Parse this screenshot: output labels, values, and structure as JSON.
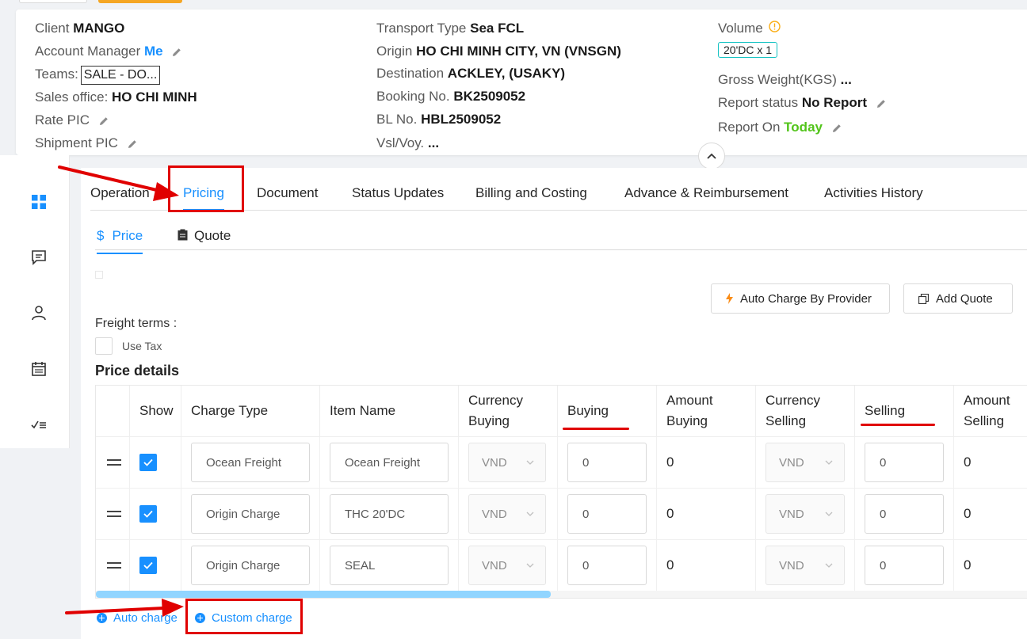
{
  "info": {
    "client_label": "Client",
    "client_value": "MANGO",
    "account_manager_label": "Account Manager",
    "account_manager_value": "Me",
    "teams_label": "Teams:",
    "teams_value": "SALE - DO...",
    "sales_office_label": "Sales office:",
    "sales_office_value": "HO CHI MINH",
    "rate_pic_label": "Rate PIC",
    "shipment_pic_label": "Shipment PIC",
    "transport_type_label": "Transport Type",
    "transport_type_value": "Sea FCL",
    "origin_label": "Origin",
    "origin_value": "HO CHI MINH CITY, VN (VNSGN)",
    "destination_label": "Destination",
    "destination_value": "ACKLEY, (USAKY)",
    "booking_label": "Booking No.",
    "booking_value": "BK2509052",
    "bl_label": "BL No.",
    "bl_value": "HBL2509052",
    "vsl_label": "Vsl/Voy.",
    "vsl_value": "...",
    "volume_label": "Volume",
    "volume_tag": "20'DC x 1",
    "gross_weight_label": "Gross Weight(KGS)",
    "gross_weight_value": "...",
    "report_status_label": "Report status",
    "report_status_value": "No Report",
    "report_on_label": "Report On",
    "report_on_value": "Today"
  },
  "tabs": [
    "Operation",
    "Pricing",
    "Document",
    "Status Updates",
    "Billing and Costing",
    "Advance & Reimbursement",
    "Activities History"
  ],
  "subtabs": {
    "price": "Price",
    "quote": "Quote"
  },
  "buttons": {
    "auto_charge_provider": "Auto Charge By Provider",
    "add_quote": "Add Quote"
  },
  "freight_terms_label": "Freight terms :",
  "use_tax_label": "Use Tax",
  "price_details_title": "Price details",
  "table": {
    "headers": {
      "show": "Show",
      "charge_type": "Charge Type",
      "item_name": "Item Name",
      "currency_buying_1": "Currency",
      "currency_buying_2": "Buying",
      "buying": "Buying",
      "amount_buying_1": "Amount",
      "amount_buying_2": "Buying",
      "currency_selling_1": "Currency",
      "currency_selling_2": "Selling",
      "selling": "Selling",
      "amount_selling_1": "Amount",
      "amount_selling_2": "Selling"
    },
    "rows": [
      {
        "charge_type": "Ocean Freight",
        "item_name": "Ocean Freight",
        "currency_buying": "VND",
        "buying": "0",
        "amount_buying": "0",
        "currency_selling": "VND",
        "selling": "0",
        "amount_selling": "0"
      },
      {
        "charge_type": "Origin Charge",
        "item_name": "THC 20'DC",
        "currency_buying": "VND",
        "buying": "0",
        "amount_buying": "0",
        "currency_selling": "VND",
        "selling": "0",
        "amount_selling": "0"
      },
      {
        "charge_type": "Origin Charge",
        "item_name": "SEAL",
        "currency_buying": "VND",
        "buying": "0",
        "amount_buying": "0",
        "currency_selling": "VND",
        "selling": "0",
        "amount_selling": "0"
      }
    ]
  },
  "links": {
    "auto_charge": "Auto charge",
    "custom_charge": "Custom charge"
  },
  "colors": {
    "accent": "#1890ff",
    "annotation": "#e00000",
    "green": "#52c41a"
  }
}
